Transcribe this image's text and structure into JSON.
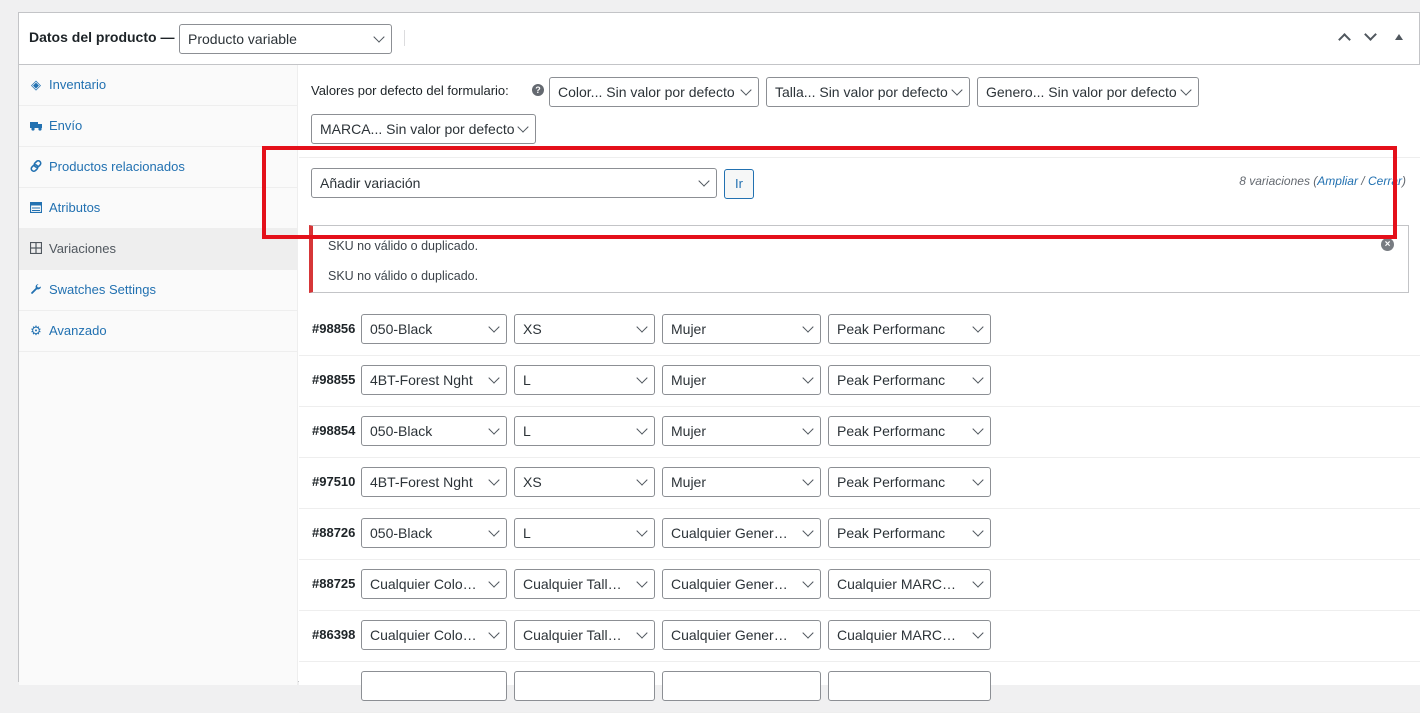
{
  "header": {
    "title": "Datos del producto —",
    "product_type": "Producto variable"
  },
  "sidebar": {
    "items": [
      {
        "label": "Inventario",
        "icon": "inventory-tag-icon"
      },
      {
        "label": "Envío",
        "icon": "truck-icon"
      },
      {
        "label": "Productos relacionados",
        "icon": "link-icon"
      },
      {
        "label": "Atributos",
        "icon": "table-icon"
      },
      {
        "label": "Variaciones",
        "icon": "grid-icon",
        "active": true
      },
      {
        "label": "Swatches Settings",
        "icon": "wrench-icon"
      },
      {
        "label": "Avanzado",
        "icon": "gear-icon"
      }
    ]
  },
  "defaults": {
    "label": "Valores por defecto del formulario:",
    "help": "?",
    "selects": [
      "Color... Sin valor por defecto",
      "Talla... Sin valor por defecto",
      "Genero... Sin valor por defecto",
      "MARCA... Sin valor por defecto"
    ]
  },
  "toolbar": {
    "add_variation": "Añadir variación",
    "go_label": "Ir",
    "count_text": "8 variaciones (",
    "expand": "Ampliar",
    "slash": " / ",
    "close": "Cerrar",
    "close_paren": ")"
  },
  "notice": {
    "messages": [
      "SKU no válido o duplicado.",
      "SKU no válido o duplicado."
    ],
    "dismiss": "×"
  },
  "variations": [
    {
      "id": "#98856",
      "color": "050-Black",
      "size": "XS",
      "gender": "Mujer",
      "brand": "Peak Performanc"
    },
    {
      "id": "#98855",
      "color": "4BT-Forest Nght",
      "size": "L",
      "gender": "Mujer",
      "brand": "Peak Performanc"
    },
    {
      "id": "#98854",
      "color": "050-Black",
      "size": "L",
      "gender": "Mujer",
      "brand": "Peak Performanc"
    },
    {
      "id": "#97510",
      "color": "4BT-Forest Nght",
      "size": "XS",
      "gender": "Mujer",
      "brand": "Peak Performanc"
    },
    {
      "id": "#88726",
      "color": "050-Black",
      "size": "L",
      "gender": "Cualquier Genero…",
      "brand": "Peak Performanc"
    },
    {
      "id": "#88725",
      "color": "Cualquier Color…",
      "size": "Cualquier Talla…",
      "gender": "Cualquier Genero…",
      "brand": "Cualquier MARCA…"
    },
    {
      "id": "#86398",
      "color": "Cualquier Color…",
      "size": "Cualquier Talla…",
      "gender": "Cualquier Genero…",
      "brand": "Cualquier MARCA…"
    },
    {
      "id": "",
      "color": "",
      "size": "",
      "gender": "",
      "brand": ""
    }
  ],
  "colors": {
    "link": "#2271b1",
    "error_border": "#d63638",
    "highlight_box": "#e4101a"
  }
}
